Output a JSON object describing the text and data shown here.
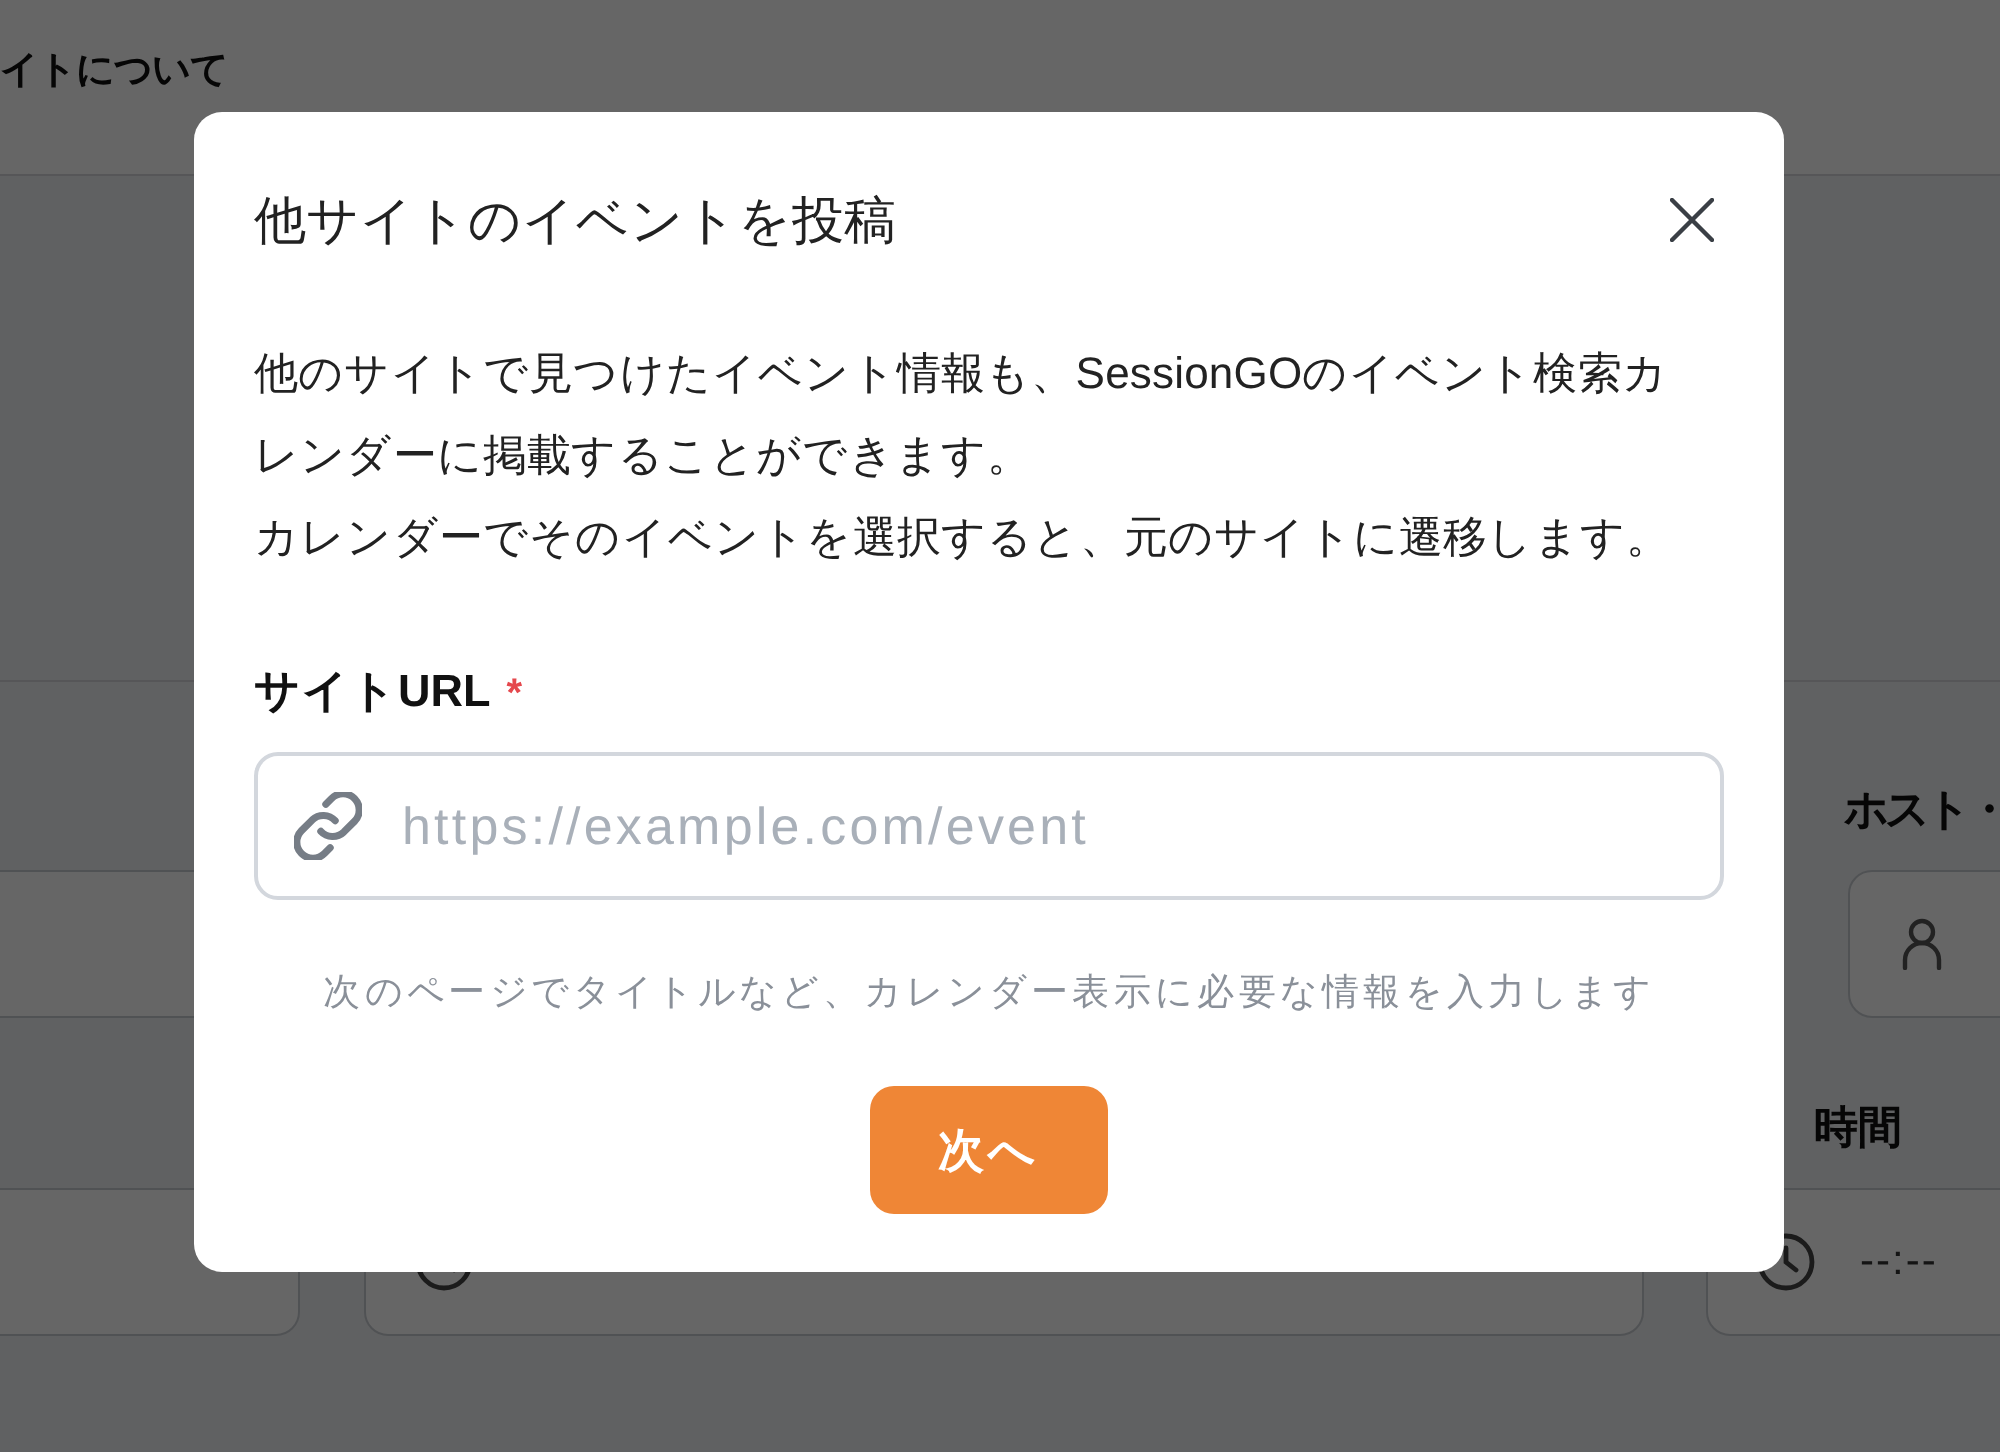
{
  "background_page": {
    "nav_link": "イトについて",
    "host_label": "ホスト・",
    "end_time_label": "時間",
    "end_time_value": "--:--"
  },
  "dialog": {
    "title": "他サイトのイベントを投稿",
    "description": [
      "他のサイトで見つけたイベント情報も、SessionGOのイベント検索カレンダーに掲載することができます。",
      "カレンダーでそのイベントを選択すると、元のサイトに遷移します。"
    ],
    "url_field": {
      "label": "サイトURL",
      "required": true,
      "required_mark": "*",
      "placeholder": "https://example.com/event"
    },
    "hint": "次のページでタイトルなど、カレンダー表示に必要な情報を入力します",
    "next_button": "次へ"
  }
}
